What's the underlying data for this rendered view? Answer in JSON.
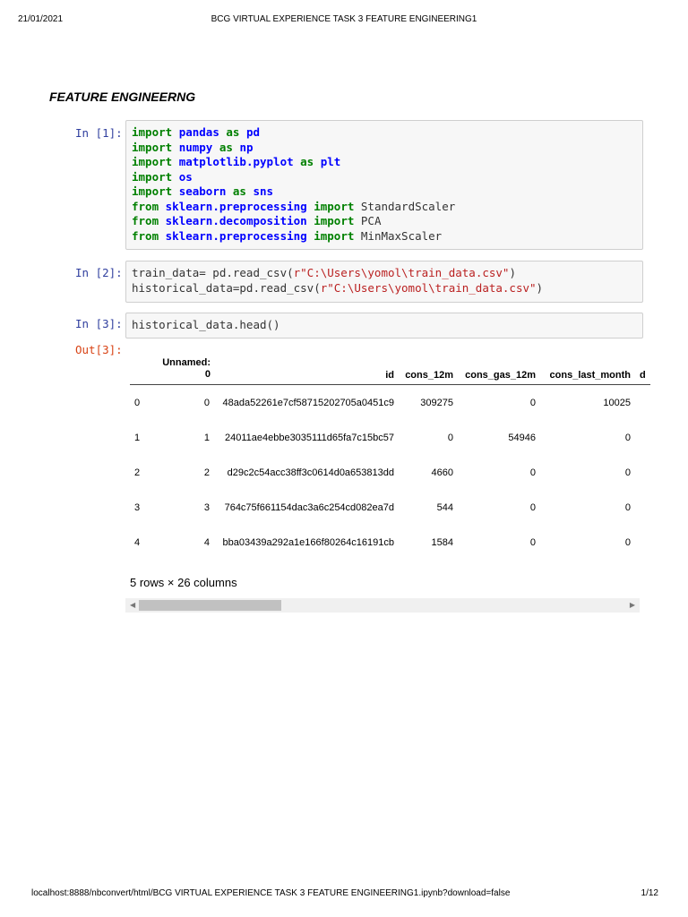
{
  "header": {
    "date": "21/01/2021",
    "title": "BCG VIRTUAL EXPERIENCE TASK 3 FEATURE ENGINEERING1"
  },
  "heading": "FEATURE ENGINEERNG",
  "cells": [
    {
      "prompt": "In [1]:",
      "lines": [
        [
          [
            "kw",
            "import"
          ],
          [
            "pl",
            " "
          ],
          [
            "nm",
            "pandas"
          ],
          [
            "pl",
            " "
          ],
          [
            "kw",
            "as"
          ],
          [
            "pl",
            " "
          ],
          [
            "nm",
            "pd"
          ]
        ],
        [
          [
            "kw",
            "import"
          ],
          [
            "pl",
            " "
          ],
          [
            "nm",
            "numpy"
          ],
          [
            "pl",
            " "
          ],
          [
            "kw",
            "as"
          ],
          [
            "pl",
            " "
          ],
          [
            "nm",
            "np"
          ]
        ],
        [
          [
            "kw",
            "import"
          ],
          [
            "pl",
            " "
          ],
          [
            "nm",
            "matplotlib.pyplot"
          ],
          [
            "pl",
            " "
          ],
          [
            "kw",
            "as"
          ],
          [
            "pl",
            " "
          ],
          [
            "nm",
            "plt"
          ]
        ],
        [
          [
            "kw",
            "import"
          ],
          [
            "pl",
            " "
          ],
          [
            "nm",
            "os"
          ]
        ],
        [
          [
            "kw",
            "import"
          ],
          [
            "pl",
            " "
          ],
          [
            "nm",
            "seaborn"
          ],
          [
            "pl",
            " "
          ],
          [
            "kw",
            "as"
          ],
          [
            "pl",
            " "
          ],
          [
            "nm",
            "sns"
          ]
        ],
        [
          [
            "kw",
            "from"
          ],
          [
            "pl",
            " "
          ],
          [
            "nm",
            "sklearn.preprocessing"
          ],
          [
            "pl",
            " "
          ],
          [
            "kw",
            "import"
          ],
          [
            "pl",
            " StandardScaler"
          ]
        ],
        [
          [
            "kw",
            "from"
          ],
          [
            "pl",
            " "
          ],
          [
            "nm",
            "sklearn.decomposition"
          ],
          [
            "pl",
            " "
          ],
          [
            "kw",
            "import"
          ],
          [
            "pl",
            " PCA"
          ]
        ],
        [
          [
            "kw",
            "from"
          ],
          [
            "pl",
            " "
          ],
          [
            "nm",
            "sklearn.preprocessing"
          ],
          [
            "pl",
            " "
          ],
          [
            "kw",
            "import"
          ],
          [
            "pl",
            " MinMaxScaler"
          ]
        ]
      ]
    },
    {
      "prompt": "In [2]:",
      "lines": [
        [
          [
            "pl",
            "train_data= pd.read_csv("
          ],
          [
            "str",
            "r\"C:\\Users\\yomol\\train_data.csv\""
          ],
          [
            "pl",
            ")"
          ]
        ],
        [
          [
            "pl",
            "historical_data=pd.read_csv("
          ],
          [
            "str",
            "r\"C:\\Users\\yomol\\train_data.csv\""
          ],
          [
            "pl",
            ")"
          ]
        ]
      ]
    },
    {
      "prompt": "In [3]:",
      "lines": [
        [
          [
            "pl",
            "historical_data.head()"
          ]
        ]
      ]
    }
  ],
  "output": {
    "prompt": "Out[3]:",
    "columns": [
      "",
      "Unnamed: 0",
      "id",
      "cons_12m",
      "cons_gas_12m",
      "cons_last_month",
      "d"
    ],
    "rows": [
      [
        "0",
        "0",
        "48ada52261e7cf58715202705a0451c9",
        "309275",
        "0",
        "10025",
        ""
      ],
      [
        "1",
        "1",
        "24011ae4ebbe3035111d65fa7c15bc57",
        "0",
        "54946",
        "0",
        ""
      ],
      [
        "2",
        "2",
        "d29c2c54acc38ff3c0614d0a653813dd",
        "4660",
        "0",
        "0",
        ""
      ],
      [
        "3",
        "3",
        "764c75f661154dac3a6c254cd082ea7d",
        "544",
        "0",
        "0",
        ""
      ],
      [
        "4",
        "4",
        "bba03439a292a1e166f80264c16191cb",
        "1584",
        "0",
        "0",
        ""
      ]
    ],
    "summary": "5 rows × 26 columns"
  },
  "footer": {
    "url": "localhost:8888/nbconvert/html/BCG VIRTUAL EXPERIENCE TASK 3 FEATURE ENGINEERING1.ipynb?download=false",
    "page": "1/12"
  }
}
